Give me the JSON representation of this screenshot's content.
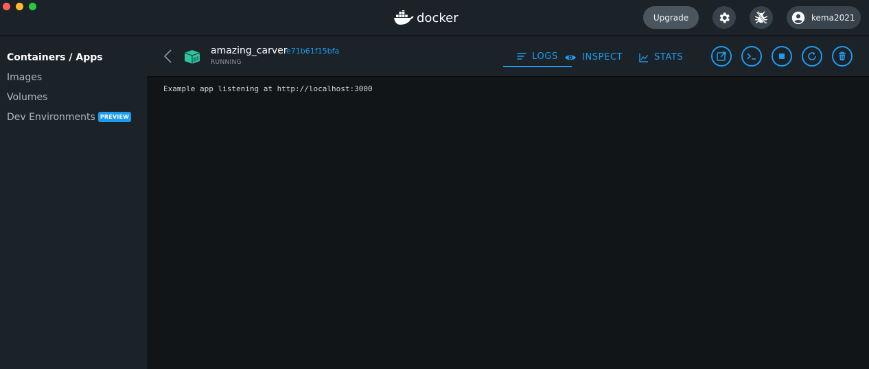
{
  "titlebar": {
    "logo_text": "docker",
    "upgrade_label": "Upgrade",
    "settings_icon": "gear-icon",
    "troubleshoot_icon": "bug-icon",
    "account_icon": "user-icon",
    "username": "kema2021"
  },
  "sidebar": {
    "items": [
      {
        "label": "Containers / Apps",
        "active": true
      },
      {
        "label": "Images",
        "active": false
      },
      {
        "label": "Volumes",
        "active": false
      },
      {
        "label": "Dev Environments",
        "active": false,
        "badge": "PREVIEW"
      }
    ]
  },
  "container": {
    "name": "amazing_carver",
    "id": "e71b61f15bfa",
    "status": "RUNNING",
    "tabs": [
      {
        "label": "LOGS",
        "icon": "lines-icon",
        "active": true
      },
      {
        "label": "INSPECT",
        "icon": "eye-icon",
        "active": false
      },
      {
        "label": "STATS",
        "icon": "chart-icon",
        "active": false
      }
    ],
    "actions": [
      "open-in-browser-icon",
      "cli-icon",
      "stop-icon",
      "restart-icon",
      "delete-icon"
    ]
  },
  "logs": {
    "lines": [
      "Example app listening at http://localhost:3000"
    ]
  },
  "colors": {
    "accent": "#1d9bf0",
    "sidebar_bg": "#1b2329",
    "log_bg": "#111518",
    "container_icon": "#2ec4a0"
  }
}
